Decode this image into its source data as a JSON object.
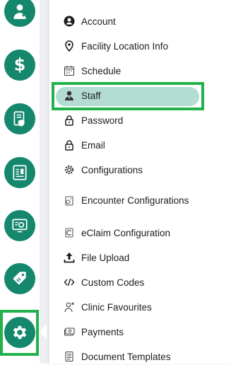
{
  "rail": {
    "accent": "#14876c",
    "frame_color": "#22b24c",
    "items": [
      {
        "icon": "doctor-icon"
      },
      {
        "icon": "dollar-icon"
      },
      {
        "icon": "document-shield-icon"
      },
      {
        "icon": "report-icon"
      },
      {
        "icon": "network-settings-icon"
      },
      {
        "icon": "discount-tag-icon"
      },
      {
        "icon": "gear-icon"
      }
    ],
    "active": "gear-icon"
  },
  "menu": {
    "selected": "Staff",
    "selected_bg": "#b3dcd3",
    "items": [
      {
        "label": "Account",
        "icon": "account-circle-icon"
      },
      {
        "label": "Facility Location Info",
        "icon": "location-pin-icon"
      },
      {
        "label": "Schedule",
        "icon": "calendar-icon"
      },
      {
        "label": "Staff",
        "icon": "staff-icon"
      },
      {
        "label": "Password",
        "icon": "lock-icon"
      },
      {
        "label": "Email",
        "icon": "lock-icon"
      },
      {
        "label": "Configurations",
        "icon": "cog-icon"
      },
      {
        "label": "Encounter Configurations",
        "icon": "encounter-config-icon"
      },
      {
        "label": "eClaim Configuration",
        "icon": "eclaim-icon"
      },
      {
        "label": "File Upload",
        "icon": "upload-icon"
      },
      {
        "label": "Custom Codes",
        "icon": "code-icon"
      },
      {
        "label": "Clinic Favourites",
        "icon": "clinic-favourites-icon"
      },
      {
        "label": "Payments",
        "icon": "payments-icon"
      },
      {
        "label": "Document Templates",
        "icon": "document-template-icon"
      }
    ]
  }
}
